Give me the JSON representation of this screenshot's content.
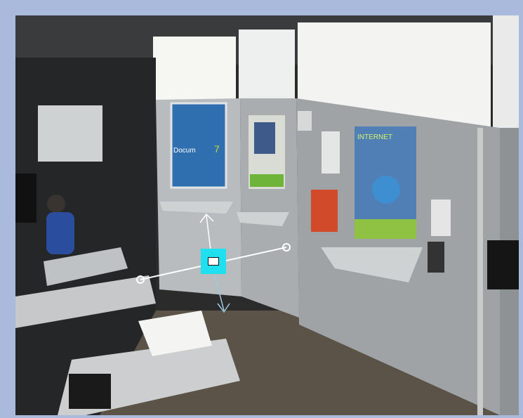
{
  "viewer": {
    "frame_color": "#a9badd",
    "overlay": {
      "handle_color": "#1ee0ee",
      "line_color": "#ffffff",
      "handle_icon": "square-handle-icon",
      "node_icon": "circle-node-icon",
      "arrow_up_icon": "arrow-up-icon",
      "arrow_down_icon": "arrow-down-icon"
    }
  },
  "scene": {
    "poster_left_text": "Docum",
    "poster_left_accent": "7",
    "poster_right_text": "INTERNET"
  }
}
